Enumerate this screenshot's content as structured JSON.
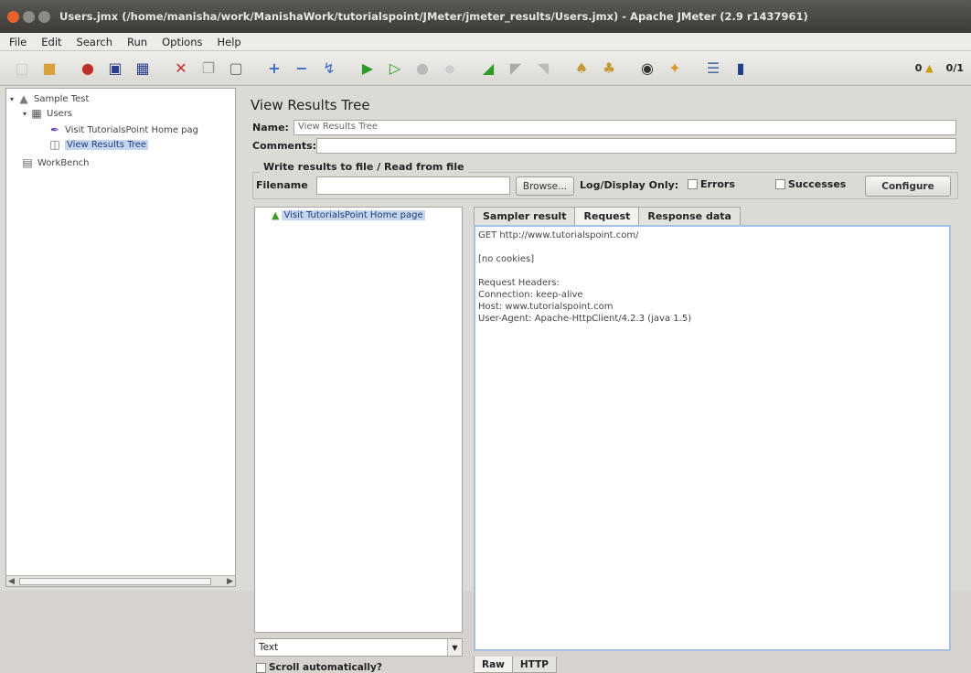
{
  "window": {
    "title": "Users.jmx (/home/manisha/work/ManishaWork/tutorialspoint/JMeter/jmeter_results/Users.jmx) - Apache JMeter (2.9 r1437961)"
  },
  "menu": [
    "File",
    "Edit",
    "Search",
    "Run",
    "Options",
    "Help"
  ],
  "toolbar": {
    "icons": [
      "new-icon",
      "open-icon",
      "templates-icon",
      "save-icon",
      "save-as-icon",
      "cut-icon",
      "copy-icon",
      "paste-icon",
      "expand-icon",
      "collapse-icon",
      "toggle-icon",
      "start-icon",
      "start-no-timers-icon",
      "stop-icon",
      "shutdown-icon",
      "remote-start-icon",
      "remote-stop-icon",
      "remote-shutdown-icon",
      "clear-icon",
      "clear-all-icon",
      "search-icon",
      "reset-search-icon",
      "function-helper-icon",
      "help-icon"
    ],
    "warnings": "0",
    "threads": "0/1"
  },
  "tree": {
    "sample_test": "Sample Test",
    "users": "Users",
    "sampler": "Visit TutorialsPoint Home pag",
    "listener": "View Results Tree",
    "workbench": "WorkBench"
  },
  "panel": {
    "title": "View Results Tree",
    "name_label": "Name:",
    "name_value": "View Results Tree",
    "comments_label": "Comments:",
    "group_label": "Write results to file / Read from file",
    "filename_label": "Filename",
    "browse_label": "Browse...",
    "log_display_label": "Log/Display Only:",
    "errors_label": "Errors",
    "successes_label": "Successes",
    "configure_label": "Configure"
  },
  "results": {
    "items": [
      "Visit TutorialsPoint Home page"
    ],
    "renderer": "Text",
    "scroll_label": "Scroll automatically?"
  },
  "tabs": [
    "Sampler result",
    "Request",
    "Response data"
  ],
  "request_text": [
    "GET http://www.tutorialspoint.com/",
    "",
    "[no cookies]",
    "",
    "Request Headers:",
    "Connection: keep-alive",
    "Host: www.tutorialspoint.com",
    "User-Agent: Apache-HttpClient/4.2.3 (java 1.5)"
  ],
  "bottom_tabs": [
    "Raw",
    "HTTP"
  ],
  "colors": {
    "selection": "#c6d6ee",
    "titlebar": "#3c3b37",
    "success": "#3d9a2a"
  }
}
